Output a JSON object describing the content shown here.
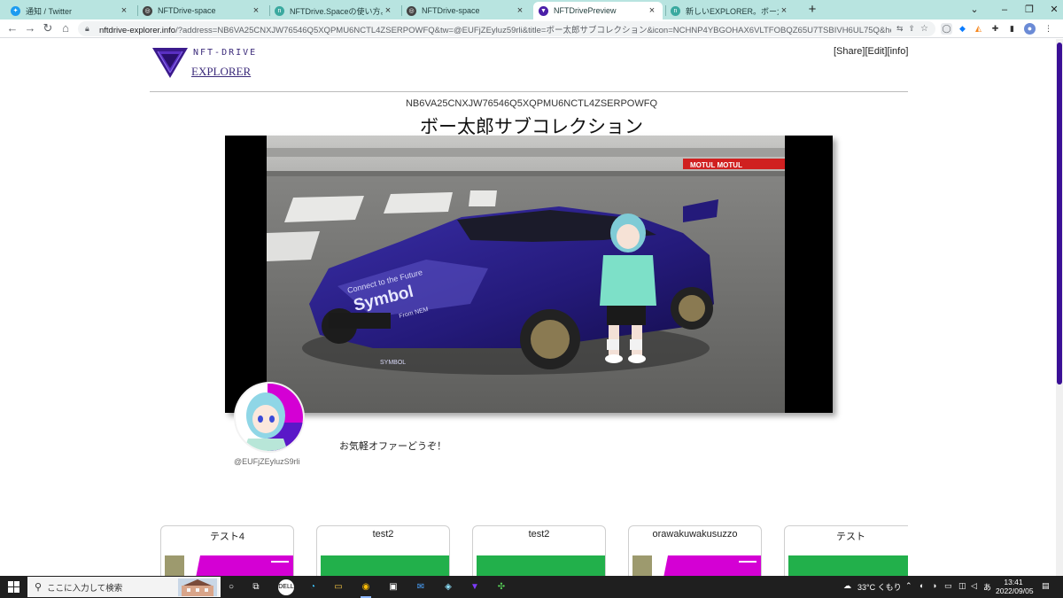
{
  "browser": {
    "tabs": [
      {
        "title": "通知 / Twitter",
        "icon": "twitter-icon",
        "color": "#1d9bf0"
      },
      {
        "title": "NFTDrive-space",
        "icon": "globe-icon",
        "color": "#444444"
      },
      {
        "title": "NFTDrive.Spaceの使い方。| 記事",
        "icon": "article-icon",
        "color": "#3aa99f"
      },
      {
        "title": "NFTDrive-space",
        "icon": "globe-icon",
        "color": "#444444"
      },
      {
        "title": "NFTDrivePreview",
        "icon": "nftdrive-icon",
        "color": "#4b1fa8",
        "active": true
      },
      {
        "title": "新しいEXPLORER。ボー太郎博士",
        "icon": "article-icon",
        "color": "#3aa99f"
      }
    ],
    "new_tab": "+",
    "url_host": "nftdrive-explorer.info",
    "url_rest": "/?address=NB6VA25CNXJW76546Q5XQPMU6NCTL4ZSERPOWFQ&tw=@EUFjZEyluz59rli&title=ボー太郎サブコレクション&icon=NCHNP4YBGOHAX6VLTFOBQZ65U7TSBIVH6UL75Q&header=NADSSFFQGXPU..."
  },
  "site": {
    "logo_text": "NFT-DRIVE",
    "explorer_link": "EXPLORER",
    "share": "[Share]",
    "edit": "[Edit]",
    "info": "[info]"
  },
  "collection": {
    "address": "NB6VA25CNXJW76546Q5XQPMU6NCTL4ZSERPOWFQ",
    "title": "ボー太郎サブコレクション",
    "owner": "@EUFjZEyluzS9rli",
    "description": "お気軽オファーどうぞ！"
  },
  "hero_art": {
    "car_text_1": "Connect to the Future",
    "car_text_2": "Symbol",
    "car_text_3": "From NEM",
    "car_text_4": "SYMBOL",
    "banner": "MOTUL MOTUL"
  },
  "cards": [
    {
      "name": "テスト4",
      "thumb": "magenta"
    },
    {
      "name": "test2",
      "thumb": "green"
    },
    {
      "name": "test2",
      "thumb": "green"
    },
    {
      "name": "orawakuwakusuzzo",
      "thumb": "magenta"
    },
    {
      "name": "テスト",
      "thumb": "green"
    }
  ],
  "taskbar": {
    "search_placeholder": "ここに入力して検索",
    "weather": "33°C くもり",
    "time": "13:41",
    "date": "2022/09/05"
  },
  "colors": {
    "tabstrip": "#b8e4e0",
    "brand": "#3b2a7a",
    "scroll_thumb": "#3a0f96",
    "card_magenta": "#d400d4",
    "card_green": "#22b04b"
  }
}
